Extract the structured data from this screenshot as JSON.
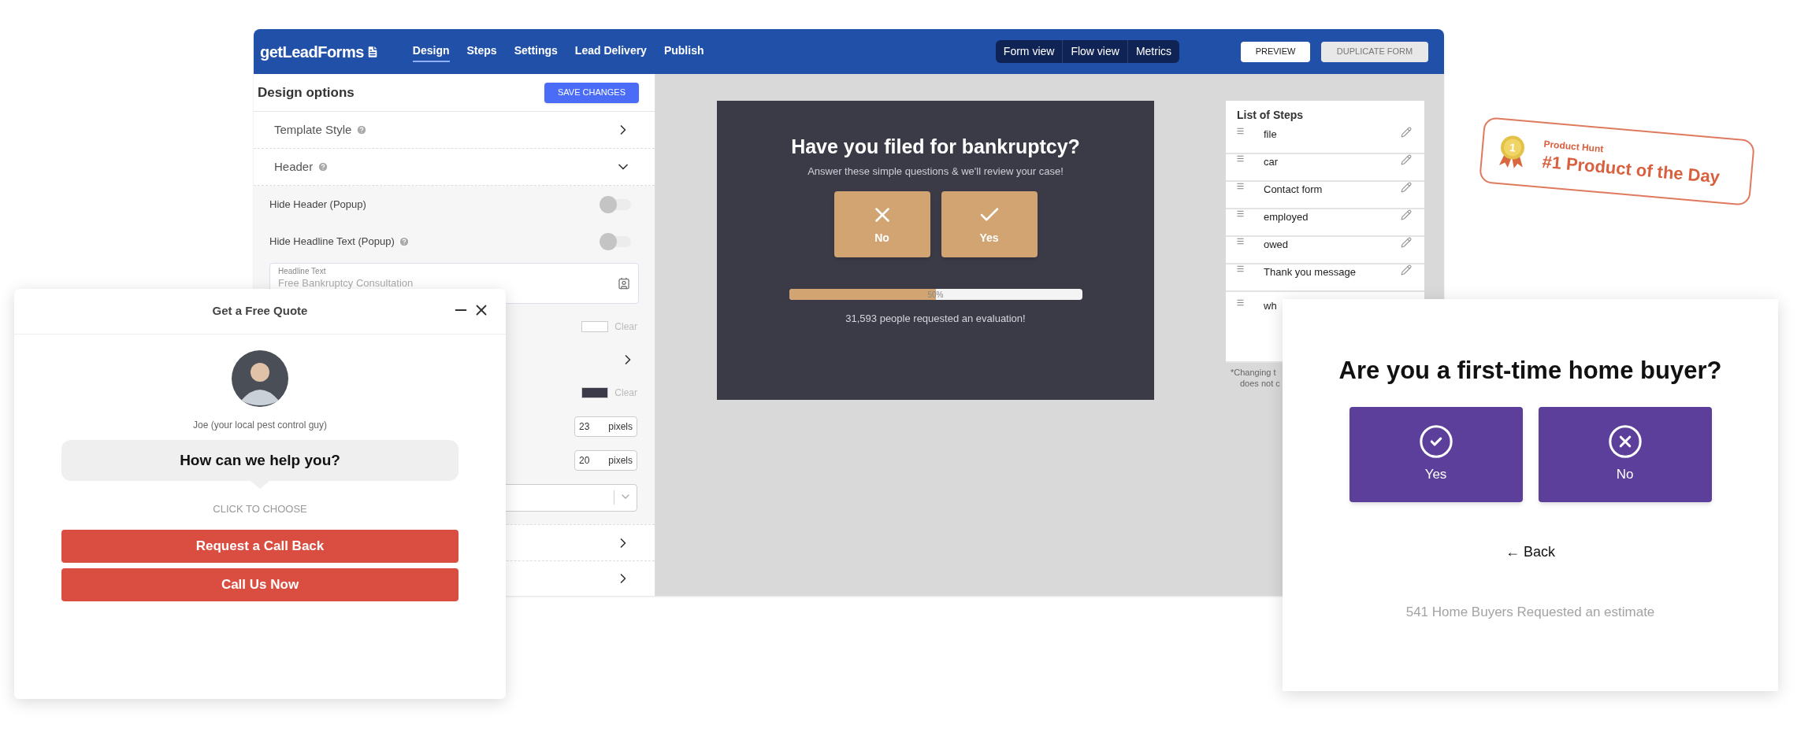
{
  "app": {
    "logo": "getLeadForms",
    "nav": [
      {
        "label": "Design",
        "selected": true
      },
      {
        "label": "Steps",
        "selected": false
      },
      {
        "label": "Settings",
        "selected": false
      },
      {
        "label": "Lead Delivery",
        "selected": false
      },
      {
        "label": "Publish",
        "selected": false
      }
    ],
    "views": [
      {
        "label": "Form view",
        "selected": false
      },
      {
        "label": "Flow view",
        "selected": false
      },
      {
        "label": "Metrics",
        "selected": false
      }
    ],
    "actions": [
      {
        "label": "PREVIEW",
        "disabled": false
      },
      {
        "label": "DUPLICATE FORM",
        "disabled": true
      }
    ]
  },
  "design_panel": {
    "title": "Design options",
    "save_button": "SAVE CHANGES",
    "sections": [
      {
        "label": "Template Style",
        "help": true,
        "expanded": false
      },
      {
        "label": "Header",
        "help": true,
        "expanded": true
      }
    ],
    "header_settings": [
      {
        "kind": "toggle",
        "label": "Hide Header (Popup)",
        "help": false,
        "on": false
      },
      {
        "kind": "toggle",
        "label": "Hide Headline Text (Popup)",
        "help": true,
        "on": false
      },
      {
        "kind": "text_field",
        "label": "Headline Text",
        "value": "Free Bankruptcy Consultation"
      },
      {
        "kind": "color",
        "color": "#ffffff",
        "action": "Clear"
      },
      {
        "kind": "link"
      },
      {
        "kind": "color",
        "color": "#3a3a48",
        "action": "Clear"
      },
      {
        "kind": "number",
        "value": "23",
        "unit": "pixels"
      },
      {
        "kind": "number",
        "value": "20",
        "unit": "pixels"
      },
      {
        "kind": "select"
      }
    ],
    "collapsed_rows": [
      {
        "expanded": false
      },
      {
        "expanded": false
      }
    ]
  },
  "form_preview": {
    "title": "Have you filed for bankruptcy?",
    "subtitle": "Answer these simple questions & we'll review your case!",
    "answers": [
      {
        "label": "No",
        "kind": "no"
      },
      {
        "label": "Yes",
        "kind": "yes"
      }
    ],
    "progress": {
      "level": 0.5,
      "reading": "50%"
    },
    "footer": "31,593 people requested an evaluation!"
  },
  "steps": {
    "title": "List of Steps",
    "items": [
      {
        "label": "file",
        "kind": "step"
      },
      {
        "label": "car",
        "kind": "step"
      },
      {
        "label": "Contact form",
        "kind": "step"
      },
      {
        "label": "employed",
        "kind": "step"
      },
      {
        "label": "owed",
        "kind": "step"
      },
      {
        "label": "Thank you message",
        "kind": "step"
      },
      {
        "label": "wh",
        "kind": "partial"
      }
    ],
    "note": [
      "*Changing t",
      "does not c"
    ]
  },
  "chat_widget": {
    "title": "Get a Free Quote",
    "agent_name": "Joe (your local pest control guy)",
    "question": "How can we help you?",
    "hint": "CLICK TO CHOOSE",
    "buttons": [
      "Request a Call Back",
      "Call Us Now"
    ]
  },
  "home_buyer_card": {
    "title": "Are you a first-time home buyer?",
    "answers": [
      {
        "label": "Yes",
        "kind": "yes"
      },
      {
        "label": "No",
        "kind": "no"
      }
    ],
    "back": "← Back",
    "footer": "541 Home Buyers Requested an estimate"
  },
  "badge": {
    "medal_number": "1",
    "eyebrow": "Product Hunt",
    "title": "#1 Product of the Day"
  }
}
